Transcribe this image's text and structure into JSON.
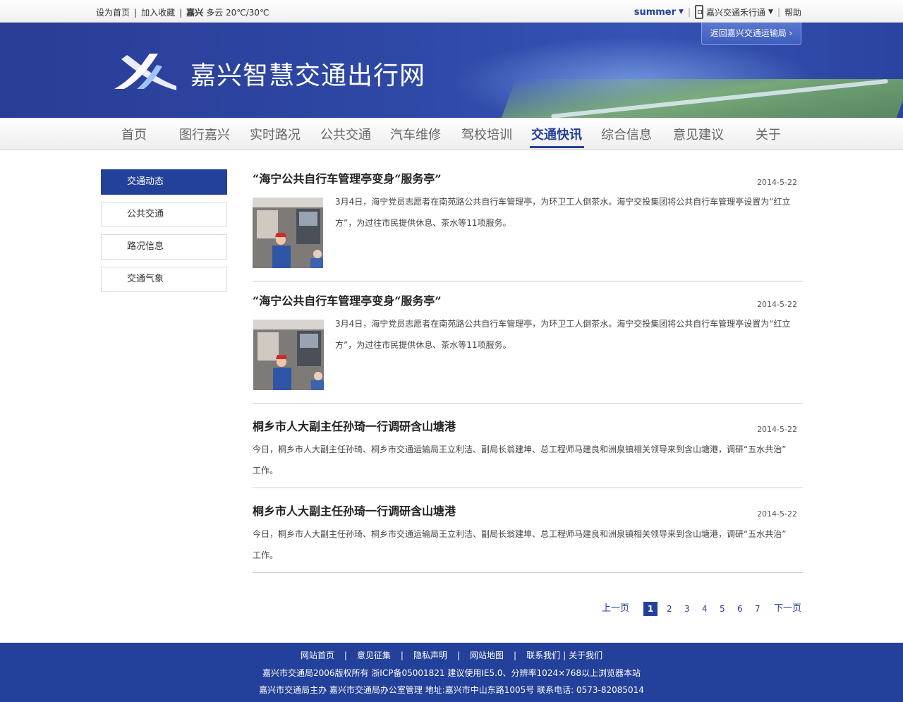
{
  "topbar": {
    "set_home": "设为首页",
    "add_favorite": "加入收藏",
    "city": "嘉兴",
    "weather": "多云 20℃/30℃",
    "username": "summer",
    "app_name": "嘉兴交通禾行通",
    "help": "帮助"
  },
  "banner": {
    "site_title": "嘉兴智慧交通出行网",
    "back_link": "返回嘉兴交通运输局 ›"
  },
  "nav": {
    "items": [
      "首页",
      "图行嘉兴",
      "实时路况",
      "公共交通",
      "汽车维修",
      "驾校培训",
      "交通快讯",
      "综合信息",
      "意见建议",
      "关于"
    ],
    "active": "交通快讯"
  },
  "sidebar": {
    "items": [
      "交通动态",
      "公共交通",
      "路况信息",
      "交通气象"
    ],
    "active": "交通动态"
  },
  "articles": [
    {
      "title": "“海宁公共自行车管理亭变身“服务亭”",
      "date": "2014-5-22",
      "body_line1": "3月4日，海宁党员志愿者在南苑路公共自行车管理亭，为环卫工人倒茶水。海宁交投集团将公共自行车管理亭设置为“红立",
      "body_line2": "方”，为过往市民提供休息、茶水等11项服务。"
    },
    {
      "title": "“海宁公共自行车管理亭变身“服务亭”",
      "date": "2014-5-22",
      "body_line1": "3月4日，海宁党员志愿者在南苑路公共自行车管理亭，为环卫工人倒茶水。海宁交投集团将公共自行车管理亭设置为“红立",
      "body_line2": "方”，为过往市民提供休息、茶水等11项服务。"
    },
    {
      "title": "桐乡市人大副主任孙琦一行调研含山塘港",
      "date": "2014-5-22",
      "body_line1": "今日，桐乡市人大副主任孙琦、桐乡市交通运输局王立利洁、副局长翁建坤、总工程师马建良和洲泉镇相关领导来到含山塘港，调研“五水共治”",
      "body_line2": "工作。"
    },
    {
      "title": "桐乡市人大副主任孙琦一行调研含山塘港",
      "date": "2014-5-22",
      "body_line1": "今日，桐乡市人大副主任孙琦、桐乡市交通运输局王立利洁、副局长翁建坤、总工程师马建良和洲泉镇相关领导来到含山塘港，调研“五水共治”",
      "body_line2": "工作。"
    }
  ],
  "pager": {
    "prev": "上一页",
    "pages": [
      "1",
      "2",
      "3",
      "4",
      "5",
      "6",
      "7"
    ],
    "current": "1",
    "next": "下一页"
  },
  "footer": {
    "links": [
      "网站首页",
      "意见征集",
      "隐私声明",
      "网站地图",
      "联系我们"
    ],
    "about": "关于我们",
    "copyright": "嘉兴市交通局2006版权所有 浙ICP备05001821 建议使用IE5.0、分辨率1024×768以上浏览器本站",
    "address": "嘉兴市交通局主办 嘉兴市交通局办公室管理  地址:嘉兴市中山东路1005号 联系电话: 0573-82085014"
  },
  "colors": {
    "brand_blue": "#23409a"
  }
}
